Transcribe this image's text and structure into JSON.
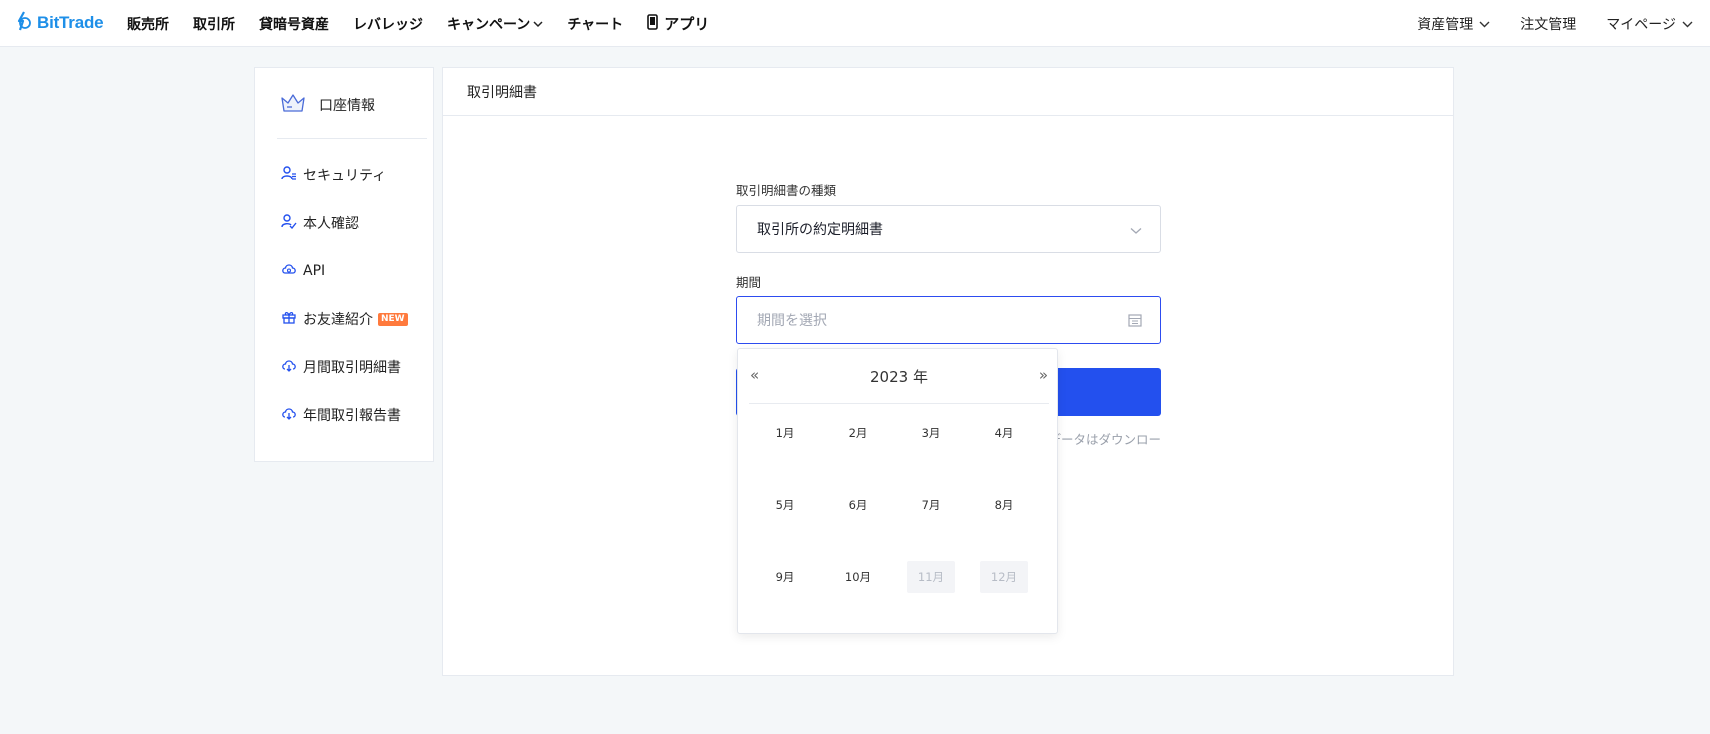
{
  "brand": {
    "name": "BitTrade",
    "color": "#1e8fe8",
    "icon": "bittrade-logo-icon"
  },
  "nav": {
    "left": [
      {
        "label": "販売所"
      },
      {
        "label": "取引所"
      },
      {
        "label": "貸暗号資産"
      },
      {
        "label": "レバレッジ"
      },
      {
        "label": "キャンペーン",
        "dropdown": true
      },
      {
        "label": "チャート"
      },
      {
        "label": "アプリ",
        "icon": "phone-icon"
      }
    ],
    "right": [
      {
        "label": "資産管理",
        "dropdown": true
      },
      {
        "label": "注文管理"
      },
      {
        "label": "マイページ",
        "dropdown": true
      }
    ]
  },
  "sidebar": {
    "header": {
      "label": "口座情報",
      "icon": "crown-icon"
    },
    "items": [
      {
        "label": "セキュリティ",
        "icon": "user-shield-icon"
      },
      {
        "label": "本人確認",
        "icon": "user-check-icon"
      },
      {
        "label": "API",
        "icon": "cloud-link-icon"
      },
      {
        "label": "お友達紹介",
        "icon": "gift-icon",
        "badge": "NEW"
      },
      {
        "label": "月間取引明細書",
        "icon": "cloud-download-icon"
      },
      {
        "label": "年間取引報告書",
        "icon": "cloud-download-icon"
      }
    ]
  },
  "main": {
    "title": "取引明細書",
    "type_label": "取引明細書の種類",
    "type_value": "取引所の約定明細書",
    "period_label": "期間",
    "period_placeholder": "期間を選択",
    "hint": "データはダウンロー"
  },
  "picker": {
    "year_label": "2023 年",
    "prev": "«",
    "next": "»",
    "months": [
      {
        "label": "1月",
        "disabled": false
      },
      {
        "label": "2月",
        "disabled": false
      },
      {
        "label": "3月",
        "disabled": false
      },
      {
        "label": "4月",
        "disabled": false
      },
      {
        "label": "5月",
        "disabled": false
      },
      {
        "label": "6月",
        "disabled": false
      },
      {
        "label": "7月",
        "disabled": false
      },
      {
        "label": "8月",
        "disabled": false
      },
      {
        "label": "9月",
        "disabled": false
      },
      {
        "label": "10月",
        "disabled": false
      },
      {
        "label": "11月",
        "disabled": true
      },
      {
        "label": "12月",
        "disabled": true
      }
    ]
  },
  "colors": {
    "accent": "#2350ee",
    "badge": "#ff7a3d",
    "background": "#f4f7f9"
  }
}
